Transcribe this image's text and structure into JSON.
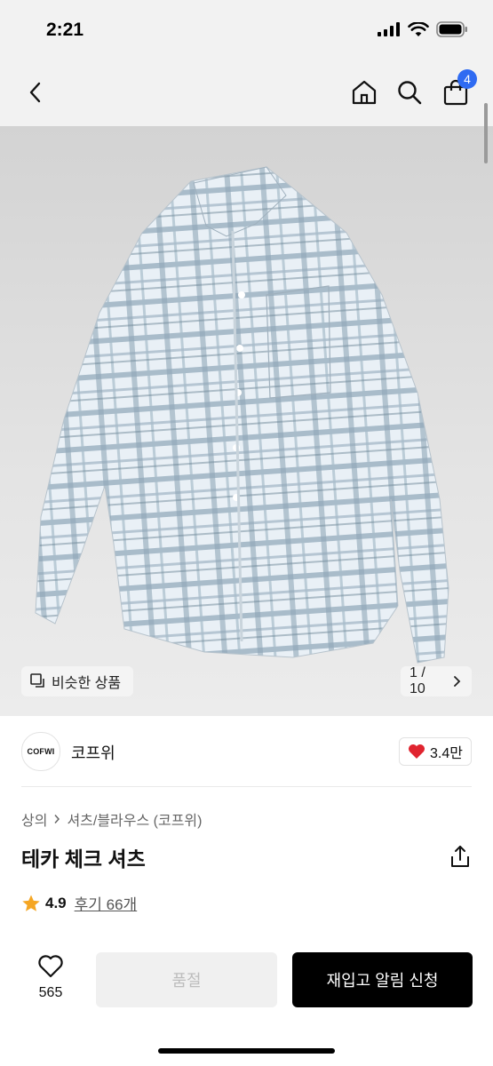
{
  "status": {
    "time": "2:21"
  },
  "header": {
    "cart_count": "4"
  },
  "hero": {
    "similar_label": "비슷한 상품",
    "pager": "1 / 10"
  },
  "brand": {
    "logo_text": "COFWI",
    "name": "코프위",
    "likes": "3.4만"
  },
  "breadcrumb": {
    "category": "상의",
    "subcategory": "셔츠/블라우스 (코프위)"
  },
  "product": {
    "title": "테카 체크 셔츠",
    "rating": "4.9",
    "reviews": "후기 66개"
  },
  "bottom": {
    "wish_count": "565",
    "soldout_label": "품절",
    "notify_label": "재입고 알림 신청"
  },
  "colors": {
    "accent": "#2f6bf2",
    "like": "#e0242f",
    "star": "#f5a623"
  }
}
